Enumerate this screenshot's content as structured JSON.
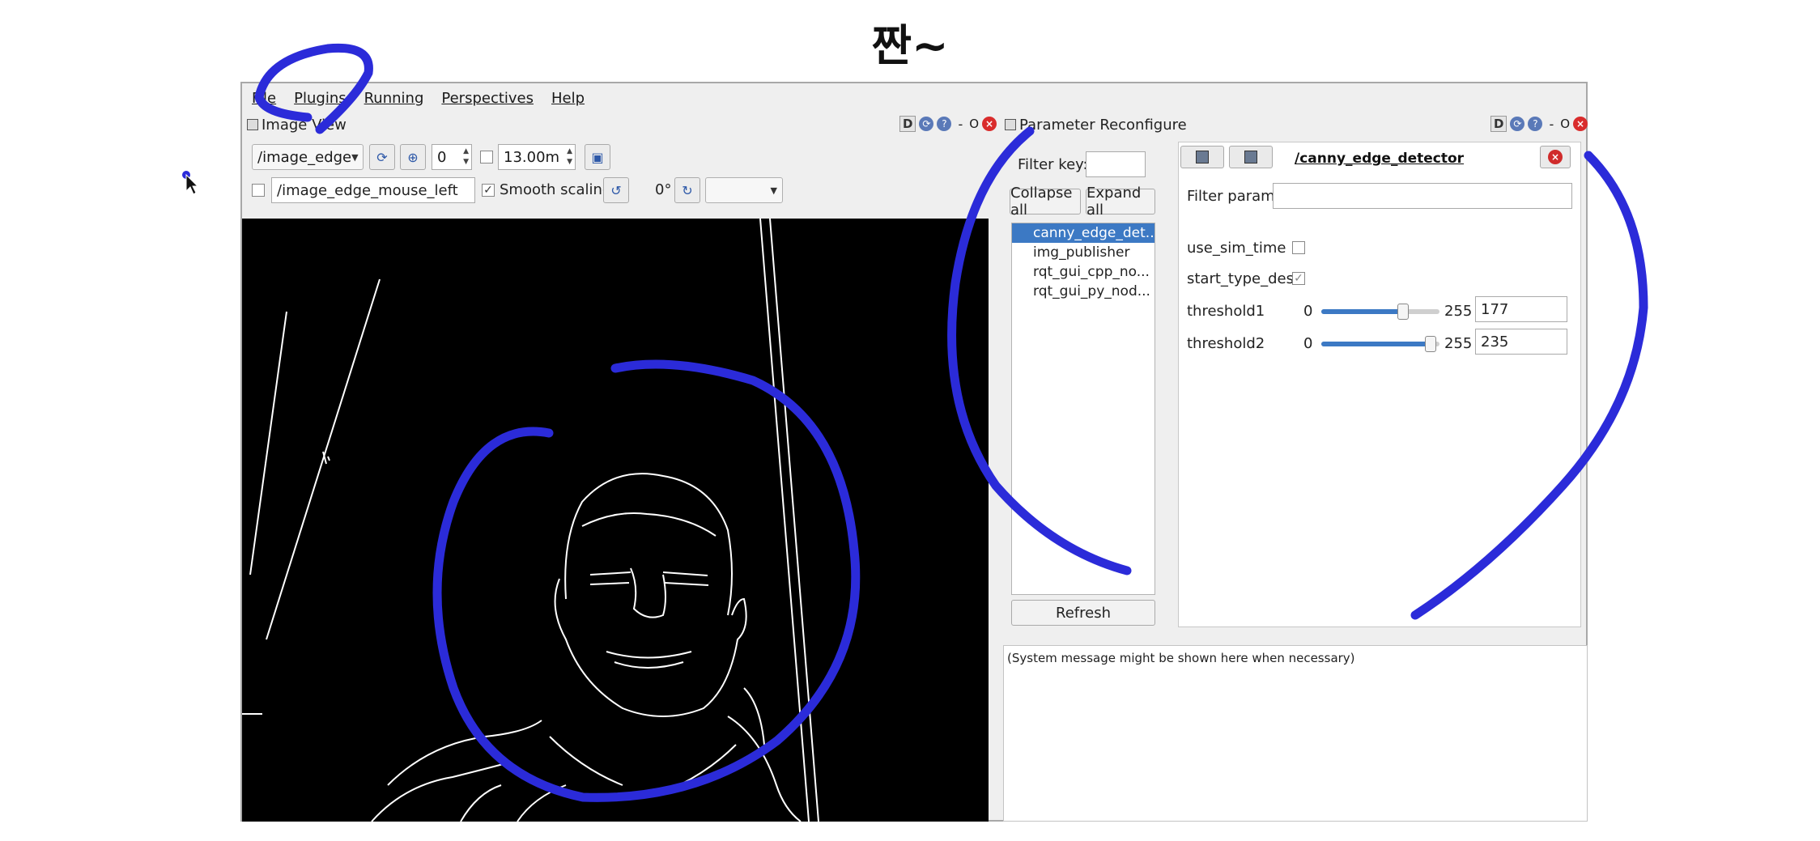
{
  "slide": {
    "title": "짠~"
  },
  "menu": {
    "file": "File",
    "plugins": "Plugins",
    "running": "Running",
    "perspectives": "Perspectives",
    "help": "Help"
  },
  "image_view": {
    "title": "Image View",
    "topic": "/image_edge",
    "zoom_value": "0",
    "timeout_value": "13.00m",
    "mouse_topic": "/image_edge_mouse_left",
    "smooth_scaling_label": "Smooth scaling",
    "smooth_scaling_checked": true,
    "rotation_label": "0°",
    "dock_d": "D",
    "dock_o": "O"
  },
  "param_reconfigure": {
    "title": "Parameter Reconfigure",
    "filter_key_label": "Filter key:",
    "collapse_all": "Collapse all",
    "expand_all": "Expand all",
    "nodes": [
      "canny_edge_det...",
      "img_publisher",
      "rqt_gui_cpp_no...",
      "rqt_gui_py_nod..."
    ],
    "refresh": "Refresh",
    "node_title": "/canny_edge_detector",
    "filter_param_label": "Filter param:",
    "use_sim_time_label": "use_sim_time",
    "start_type_label": "start_type_des",
    "threshold1": {
      "label": "threshold1",
      "min": "0",
      "max": "255",
      "value": "177",
      "fraction": 0.694
    },
    "threshold2": {
      "label": "threshold2",
      "min": "0",
      "max": "255",
      "value": "235",
      "fraction": 0.922
    },
    "system_message": "(System message might be shown here when necessary)",
    "dock_d": "D",
    "dock_o": "O"
  },
  "colors": {
    "annotation": "#2b2bd9",
    "selection": "#3c79c4",
    "close": "#d92c2c"
  }
}
